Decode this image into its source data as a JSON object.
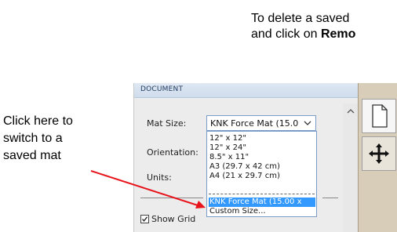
{
  "instructions": {
    "top_line1": "To delete a saved",
    "top_line2_prefix": "and click on ",
    "top_line2_bold": "Remo"
  },
  "callout": {
    "line1": "Click here to",
    "line2": "switch to a",
    "line3": "saved mat"
  },
  "panel": {
    "header": "DOCUMENT",
    "mat_size_label": "Mat Size:",
    "orientation_label": "Orientation:",
    "units_label": "Units:",
    "selected_value": "KNK Force Mat (15.0",
    "options": [
      "12\" x 12\"",
      "12\" x 24\"",
      "8.5\" x 11\"",
      "A3 (29.7 x 42 cm)",
      "A4 (21 x 29.7 cm)",
      "KNK Force Mat (15.00 x",
      "Custom Size..."
    ],
    "selected_option_index": 5,
    "show_grid_label": "Show Grid",
    "show_grid_checked": true
  },
  "colors": {
    "selection": "#3399ff",
    "arrow": "#e8141b",
    "header_text": "#1e3a5f"
  },
  "icons": {
    "page_tool": "page-icon",
    "move_tool": "move-arrows-icon"
  }
}
